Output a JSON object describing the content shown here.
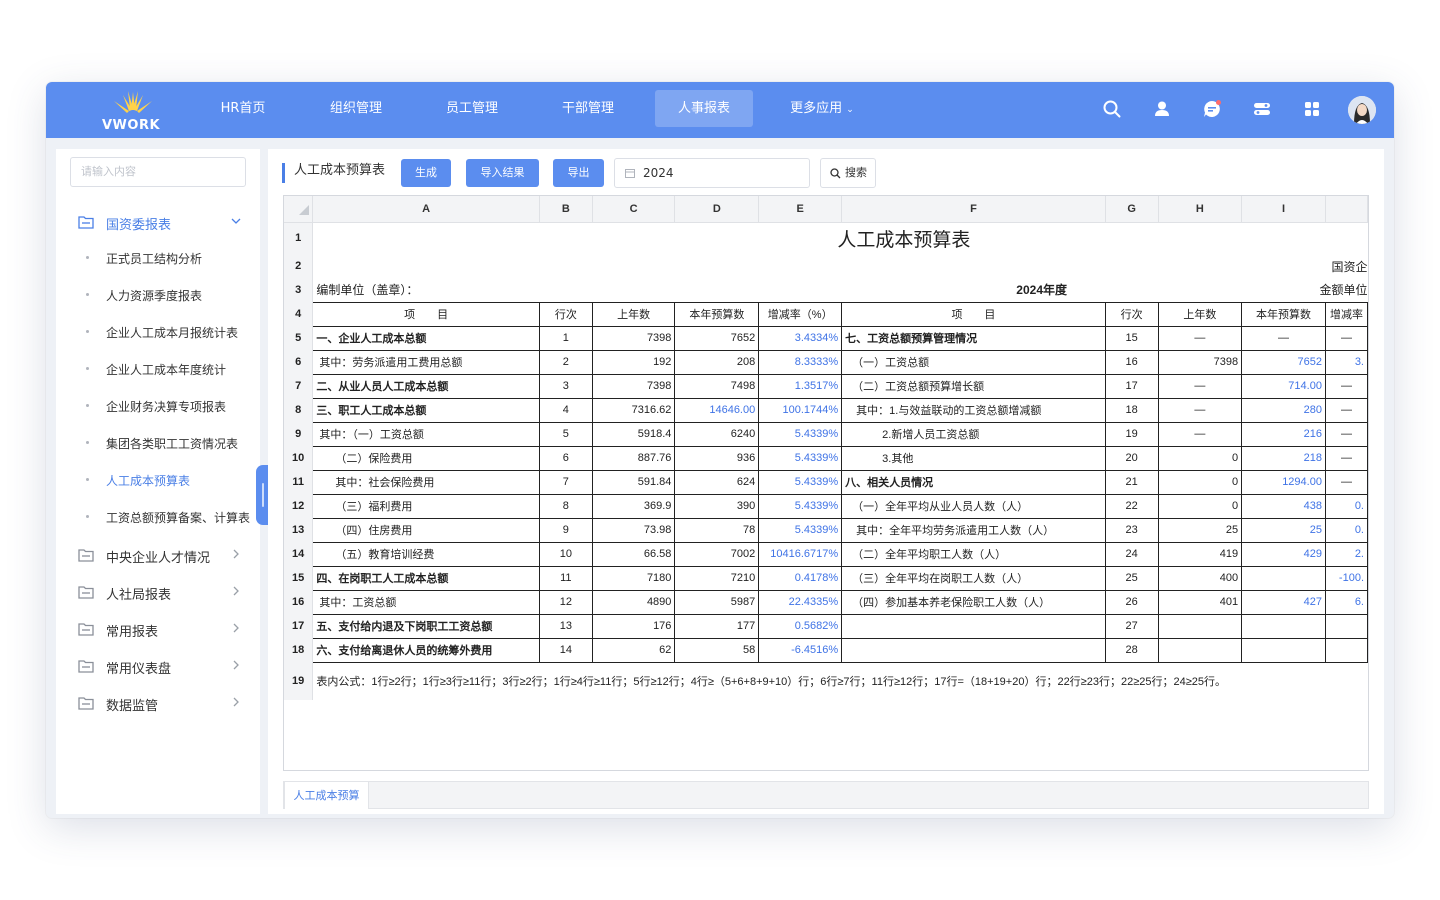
{
  "app": {
    "logo_text": "VWORK"
  },
  "nav": [
    {
      "label": "HR首页"
    },
    {
      "label": "组织管理"
    },
    {
      "label": "员工管理"
    },
    {
      "label": "干部管理"
    },
    {
      "label": "人事报表"
    },
    {
      "label": "更多应用"
    }
  ],
  "header_icons": [
    "search-icon",
    "user-icon",
    "chat-icon",
    "toggle-icon",
    "apps-grid-icon"
  ],
  "sidebar": {
    "search_placeholder": "请输入内容",
    "groups": [
      {
        "label": "国资委报表",
        "open": true,
        "items": [
          "正式员工结构分析",
          "人力资源季度报表",
          "企业人工成本月报统计表",
          "企业人工成本年度统计",
          "企业财务决算专项报表",
          "集团各类职工工资情况表",
          "人工成本预算表",
          "工资总额预算备案、计算表"
        ]
      },
      {
        "label": "中央企业人才情况"
      },
      {
        "label": "人社局报表"
      },
      {
        "label": "常用报表"
      },
      {
        "label": "常用仪表盘"
      },
      {
        "label": "数据监管"
      }
    ],
    "active_item": "人工成本预算表"
  },
  "toolbar": {
    "title": "人工成本预算表",
    "generate_label": "生成",
    "import_label": "导入结果",
    "export_label": "导出",
    "year_value": "2024",
    "search_label": "搜索"
  },
  "sheet": {
    "columns": [
      "A",
      "B",
      "C",
      "D",
      "E",
      "F",
      "G",
      "H",
      "I"
    ],
    "title": "人工成本预算表",
    "row2_right": "国资企",
    "row3_left": "编制单位（盖章）：",
    "row3_center": "2024年度",
    "row3_right": "金额单位",
    "headers": [
      "项　　目",
      "行次",
      "上年数",
      "本年预算数",
      "增减率（%）",
      "项　　目",
      "行次",
      "上年数",
      "本年预算数",
      "增减率"
    ],
    "rows": [
      [
        "一、企业人工成本总额",
        "1",
        "7398",
        "7652",
        "3.4334%",
        "七、工资总额预算管理情况",
        "15",
        "—",
        "—",
        "—"
      ],
      [
        "其中：劳务派遣用工费用总额",
        "2",
        "192",
        "208",
        "8.3333%",
        "（一）工资总额",
        "16",
        "7398",
        "7652",
        "3."
      ],
      [
        "二、从业人员人工成本总额",
        "3",
        "7398",
        "7498",
        "1.3517%",
        "（二）工资总额预算增长额",
        "17",
        "—",
        "714.00",
        "—"
      ],
      [
        "三、职工人工成本总额",
        "4",
        "7316.62",
        "14646.00",
        "100.1744%",
        "其中：1.与效益联动的工资总额增减额",
        "18",
        "—",
        "280",
        "—"
      ],
      [
        "其中：（一）工资总额",
        "5",
        "5918.4",
        "6240",
        "5.4339%",
        "2.新增人员工资总额",
        "19",
        "—",
        "216",
        "—"
      ],
      [
        "（二）保险费用",
        "6",
        "887.76",
        "936",
        "5.4339%",
        "3.其他",
        "20",
        "0",
        "218",
        "—"
      ],
      [
        "其中：社会保险费用",
        "7",
        "591.84",
        "624",
        "5.4339%",
        "八、相关人员情况",
        "21",
        "0",
        "1294.00",
        "—"
      ],
      [
        "（三）福利费用",
        "8",
        "369.9",
        "390",
        "5.4339%",
        "（一）全年平均从业人员人数（人）",
        "22",
        "0",
        "438",
        "0."
      ],
      [
        "（四）住房费用",
        "9",
        "73.98",
        "78",
        "5.4339%",
        "其中：全年平均劳务派遣用工人数（人）",
        "23",
        "25",
        "25",
        "0."
      ],
      [
        "（五）教育培训经费",
        "10",
        "66.58",
        "7002",
        "10416.6717%",
        "（二）全年平均职工人数（人）",
        "24",
        "419",
        "429",
        "2."
      ],
      [
        "四、在岗职工人工成本总额",
        "11",
        "7180",
        "7210",
        "0.4178%",
        "（三）全年平均在岗职工人数（人）",
        "25",
        "400",
        "",
        "-100."
      ],
      [
        "其中：工资总额",
        "12",
        "4890",
        "5987",
        "22.4335%",
        "（四）参加基本养老保险职工人数（人）",
        "26",
        "401",
        "427",
        "6."
      ],
      [
        "五、支付给内退及下岗职工工资总额",
        "13",
        "176",
        "177",
        "0.5682%",
        "",
        "27",
        "",
        "",
        ""
      ],
      [
        "六、支付给离退休人员的统筹外费用",
        "14",
        "62",
        "58",
        "-6.4516%",
        "",
        "28",
        "",
        "",
        ""
      ]
    ],
    "formula_note": "表内公式：1行≥2行；1行≥3行≥11行；3行≥2行；1行≥4行≥11行；5行≥12行；4行≥（5+6+8+9+10）行；6行≥7行；11行≥12行；17行=（18+19+20）行；22行≥23行；22≥25行；24≥25行。",
    "tab_label": "人工成本预算"
  },
  "colors": {
    "brand": "#5b8def",
    "link": "#3f73e6"
  }
}
